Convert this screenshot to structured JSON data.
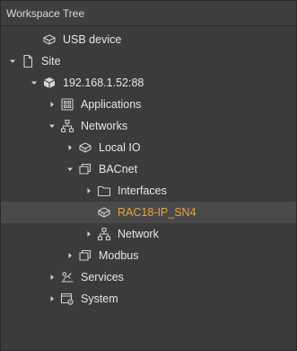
{
  "panel": {
    "title": "Workspace Tree"
  },
  "tree": [
    {
      "label": "USB device",
      "icon": "usb-device-icon",
      "level": 1,
      "caret": "none"
    },
    {
      "label": "Site",
      "icon": "document-icon",
      "level": 0,
      "caret": "expanded"
    },
    {
      "label": "192.168.1.52:88",
      "icon": "controller-icon",
      "level": 1,
      "caret": "expanded"
    },
    {
      "label": "Applications",
      "icon": "applications-icon",
      "level": 2,
      "caret": "collapsed"
    },
    {
      "label": "Networks",
      "icon": "network-icon",
      "level": 2,
      "caret": "expanded"
    },
    {
      "label": "Local IO",
      "icon": "local-io-icon",
      "level": 3,
      "caret": "collapsed"
    },
    {
      "label": "BACnet",
      "icon": "bacnet-icon",
      "level": 3,
      "caret": "expanded"
    },
    {
      "label": "Interfaces",
      "icon": "folder-icon",
      "level": 4,
      "caret": "collapsed"
    },
    {
      "label": "RAC18-IP_SN4",
      "icon": "device-icon",
      "level": 4,
      "caret": "none",
      "selected": true
    },
    {
      "label": "Network",
      "icon": "network-icon",
      "level": 4,
      "caret": "collapsed"
    },
    {
      "label": "Modbus",
      "icon": "modbus-icon",
      "level": 3,
      "caret": "collapsed"
    },
    {
      "label": "Services",
      "icon": "services-icon",
      "level": 2,
      "caret": "collapsed"
    },
    {
      "label": "System",
      "icon": "system-icon",
      "level": 2,
      "caret": "collapsed"
    }
  ],
  "colors": {
    "background": "#3b3b3b",
    "selected_text": "#e8a33a",
    "selected_row": "#4a4a4a"
  }
}
